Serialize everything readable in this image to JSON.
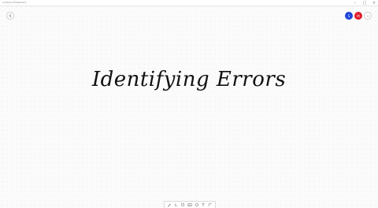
{
  "window": {
    "title": "Untitled Whiteboard"
  },
  "canvas": {
    "title": "Identifying Errors"
  },
  "header": {
    "back_icon": "arrow-left-icon",
    "avatars": [
      {
        "initial": "S",
        "color": "#1e44d8"
      },
      {
        "initial": "M",
        "color": "#e11d2a"
      },
      {
        "initial": "+",
        "color": "#ffffff"
      }
    ]
  },
  "toolbar": {
    "tools": [
      "pen-icon",
      "cursor-icon",
      "comment-icon",
      "image-icon",
      "shapes-icon",
      "text-icon",
      "more-icon"
    ]
  }
}
